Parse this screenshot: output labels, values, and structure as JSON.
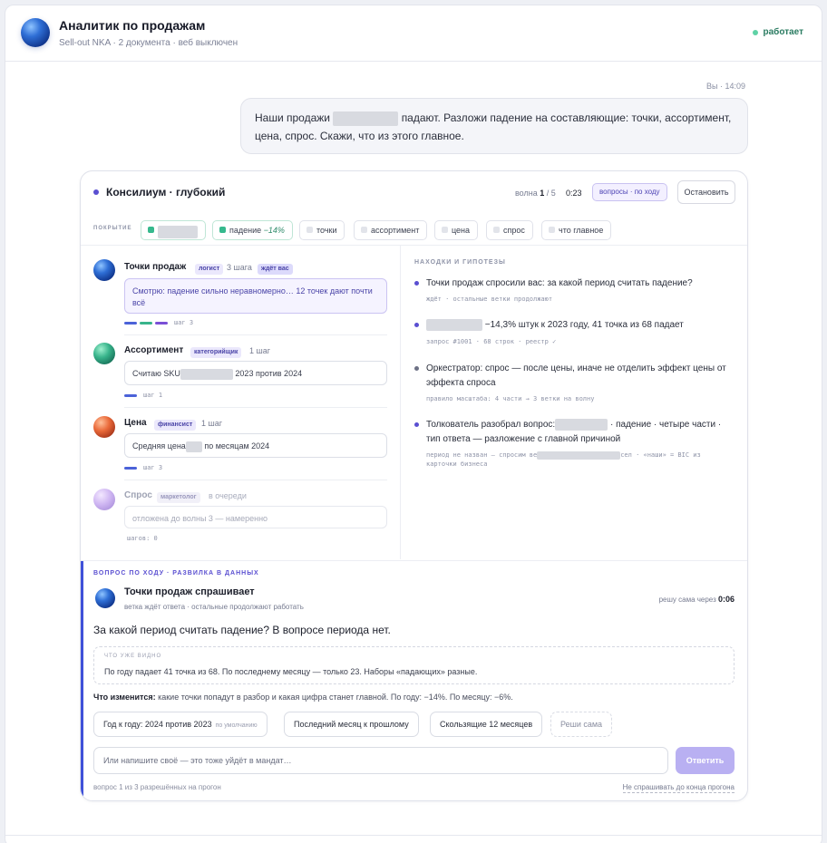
{
  "header": {
    "title": "Аналитик по продажам",
    "subtitle": "Sell-out NKA · 2 документа · веб выключен",
    "status": "работает"
  },
  "user_message": {
    "meta": "Вы · 14:09",
    "text_before": "Наши продажи",
    "text_after": "падают. Разложи падение на составляющие: точки, ассортимент, цена, спрос. Скажи, что из этого главное."
  },
  "council": {
    "title": "Консилиум · глубокий",
    "wave_label": "волна",
    "wave_current": "1",
    "wave_total": "/ 5",
    "timer": "0:23",
    "mode": "вопросы · по ходу",
    "stop_label": "Остановить",
    "coverage_label": "ПОКРЫТИЕ",
    "coverage_chips": [
      {
        "label": "падение",
        "delta": "−14%"
      },
      {
        "label": "точки"
      },
      {
        "label": "ассортимент"
      },
      {
        "label": "цена"
      },
      {
        "label": "спрос"
      },
      {
        "label": "что главное"
      }
    ],
    "agents": [
      {
        "name": "Точки продаж",
        "role": "логист",
        "steps": "3 шага",
        "badge": "ждёт вас",
        "quote": "Смотрю: падение сильно неравномерно… 12 точек дают почти всё",
        "note": "шаг 3"
      },
      {
        "name": "Ассортимент",
        "role": "категорийщик",
        "steps": "1 шаг",
        "quote_before": "Считаю SKU",
        "quote_after": "2023 против 2024",
        "note": "шаг 1"
      },
      {
        "name": "Цена",
        "role": "финансист",
        "steps": "1 шаг",
        "quote_before": "Средняя цена",
        "quote_after": "по месяцам 2024",
        "note": "шаг 3"
      },
      {
        "name": "Спрос",
        "role": "маркетолог",
        "steps": "в очереди",
        "quote": "отложена до волны 3 — намеренно",
        "note": "шагов: 0"
      }
    ],
    "findings_title": "НАХОДКИ И ГИПОТЕЗЫ",
    "findings": [
      {
        "text": "Точки продаж спросили вас: за какой период считать падение?",
        "meta": "ждёт · остальные ветки продолжают"
      },
      {
        "text": "−14,3% штук к 2023 году, 41 точка из 68 падает",
        "meta": "запрос #1001 · 68 строк · реестр ✓"
      },
      {
        "text": "Оркестратор: спрос — после цены, иначе не отделить эффект цены от эффекта спроса",
        "meta": "правило масштаба: 4 части → 3 ветки на волну"
      },
      {
        "text_before": "Толкователь разобрал вопрос:",
        "text_after": "· падение · четыре части · тип ответа — разложение с главной причиной",
        "meta_before": "период не назван — спросим ве",
        "meta_after": "сел · «наши» = BIC из карточки бизнеса"
      }
    ]
  },
  "question": {
    "label": "ВОПРОС ПО ХОДУ · РАЗВИЛКА В ДАННЫХ",
    "asker": "Точки продаж спрашивает",
    "asker_sub": "ветка ждёт ответа · остальные продолжают работать",
    "timer_label": "решу сама через",
    "timer_value": "0:06",
    "text": "За какой период считать падение? В вопросе периода нет.",
    "seen_label": "ЧТО УЖЕ ВИДНО",
    "seen_text": "По году падает 41 точка из 68. По последнему месяцу — только 23. Наборы «падающих» разные.",
    "change_label": "Что изменится:",
    "change_text": "какие точки попадут в разбор и какая цифра станет главной. По году: −14%. По месяцу: −6%.",
    "options": [
      {
        "label": "Год к году: 2024 против 2023",
        "default_note": "по умолчанию"
      },
      {
        "label": "Последний месяц к прошлому"
      },
      {
        "label": "Скользящие 12 месяцев"
      },
      {
        "label": "Реши сама"
      }
    ],
    "input_placeholder": "Или напишите своё — это тоже уйдёт в мандат…",
    "answer_label": "Ответить",
    "count": "вопрос 1 из 3 разрешённых на прогон",
    "no_ask": "Не спрашивать до конца прогона"
  },
  "colors": {
    "accent": "#5a4fd1",
    "status_green": "#2a7b61",
    "question_accent": "#3f51d9"
  }
}
